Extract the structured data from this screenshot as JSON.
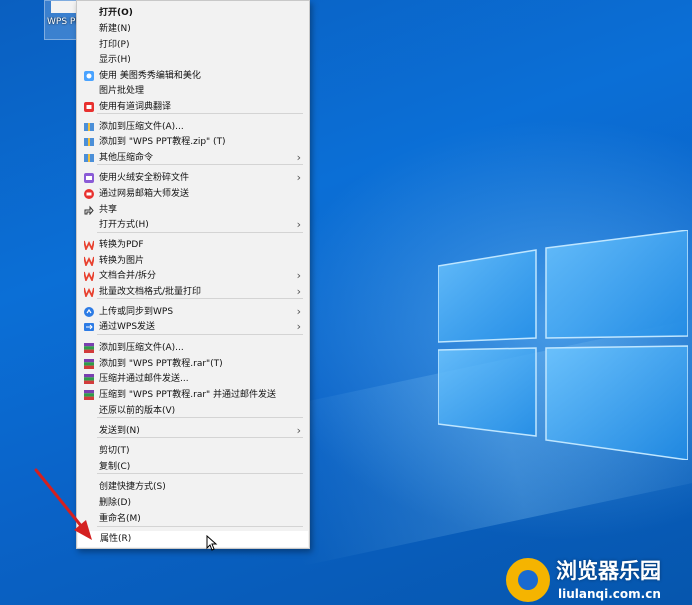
{
  "desktop": {
    "file_icon_label": "WPS PPT教程.ppt"
  },
  "menu": {
    "items": [
      {
        "label": "打开(O)",
        "icon": "none",
        "submenu": false,
        "bold": true
      },
      {
        "label": "新建(N)",
        "icon": "none",
        "submenu": false
      },
      {
        "label": "打印(P)",
        "icon": "none",
        "submenu": false
      },
      {
        "label": "显示(H)",
        "icon": "none",
        "submenu": false
      },
      {
        "label": "使用 美图秀秀编辑和美化",
        "icon": "meitu-icon",
        "submenu": false
      },
      {
        "label": "图片批处理",
        "icon": "none",
        "submenu": false
      },
      {
        "label": "使用有道词典翻译",
        "icon": "youdao-icon",
        "submenu": false
      },
      {
        "label": "添加到压缩文件(A)...",
        "icon": "archive-icon",
        "submenu": false
      },
      {
        "label": "添加到 \"WPS PPT教程.zip\" (T)",
        "icon": "archive-icon",
        "submenu": false
      },
      {
        "label": "其他压缩命令",
        "icon": "archive-icon",
        "submenu": true
      },
      {
        "label": "使用火绒安全粉碎文件",
        "icon": "huorong-icon",
        "submenu": true
      },
      {
        "label": "通过网易邮箱大师发送",
        "icon": "netease-mail-icon",
        "submenu": false
      },
      {
        "label": "共享",
        "icon": "share-icon",
        "submenu": false
      },
      {
        "label": "打开方式(H)",
        "icon": "none",
        "submenu": true
      },
      {
        "label": "转换为PDF",
        "icon": "wps-icon",
        "submenu": false
      },
      {
        "label": "转换为图片",
        "icon": "wps-icon",
        "submenu": false
      },
      {
        "label": "文档合并/拆分",
        "icon": "wps-icon",
        "submenu": true
      },
      {
        "label": "批量改文档格式/批量打印",
        "icon": "wps-icon",
        "submenu": true
      },
      {
        "label": "上传或同步到WPS",
        "icon": "wps-cloud-icon",
        "submenu": true
      },
      {
        "label": "通过WPS发送",
        "icon": "wps-send-icon",
        "submenu": true
      },
      {
        "label": "添加到压缩文件(A)...",
        "icon": "winrar-icon",
        "submenu": false
      },
      {
        "label": "添加到 \"WPS PPT教程.rar\"(T)",
        "icon": "winrar-icon",
        "submenu": false
      },
      {
        "label": "压缩并通过邮件发送...",
        "icon": "winrar-icon",
        "submenu": false
      },
      {
        "label": "压缩到 \"WPS PPT教程.rar\" 并通过邮件发送",
        "icon": "winrar-icon",
        "submenu": false
      },
      {
        "label": "还原以前的版本(V)",
        "icon": "none",
        "submenu": false
      },
      {
        "label": "发送到(N)",
        "icon": "none",
        "submenu": true
      },
      {
        "label": "剪切(T)",
        "icon": "none",
        "submenu": false
      },
      {
        "label": "复制(C)",
        "icon": "none",
        "submenu": false
      },
      {
        "label": "创建快捷方式(S)",
        "icon": "none",
        "submenu": false
      },
      {
        "label": "删除(D)",
        "icon": "none",
        "submenu": false
      },
      {
        "label": "重命名(M)",
        "icon": "none",
        "submenu": false
      },
      {
        "label": "属性(R)",
        "icon": "none",
        "submenu": false,
        "highlighted": true
      }
    ]
  },
  "watermark": {
    "title": "浏览器乐园",
    "url": "liulanqi.com.cn"
  },
  "colors": {
    "desktop_blue": "#0a63c8",
    "menu_bg": "#f2f2f2",
    "wps_red": "#e8412f",
    "annotation_arrow": "#d42020",
    "watermark_gold": "#f5b400"
  }
}
